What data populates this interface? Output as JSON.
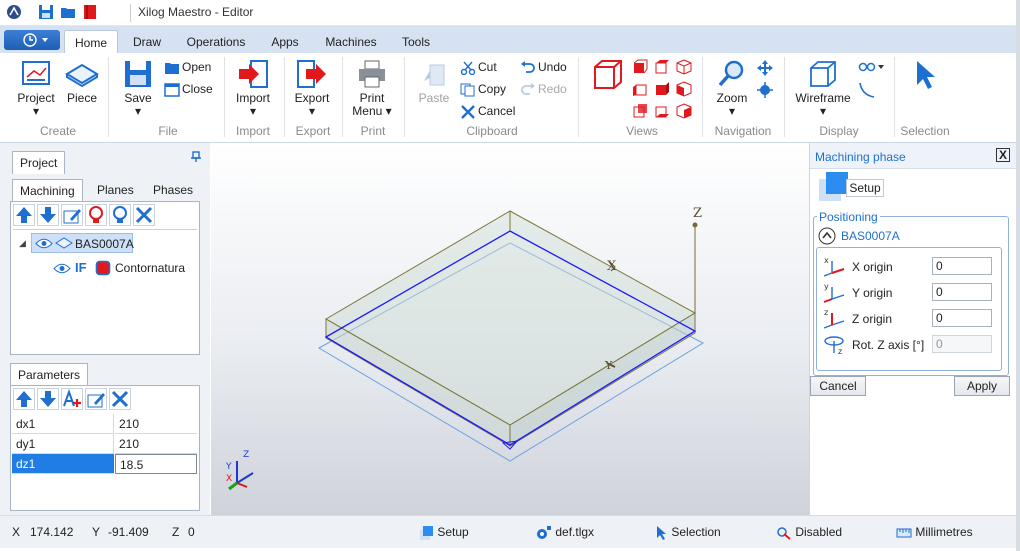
{
  "window": {
    "title": "Xilog Maestro - Editor"
  },
  "tabs": [
    {
      "label": "Home",
      "active": true
    },
    {
      "label": "Draw"
    },
    {
      "label": "Operations"
    },
    {
      "label": "Apps"
    },
    {
      "label": "Machines"
    },
    {
      "label": "Tools"
    }
  ],
  "ribbon": {
    "create": {
      "group": "Create",
      "project": "Project",
      "piece": "Piece"
    },
    "file": {
      "group": "File",
      "save": "Save",
      "open": "Open",
      "close": "Close"
    },
    "import": {
      "group": "Import",
      "import": "Import"
    },
    "export": {
      "group": "Export",
      "export": "Export"
    },
    "print": {
      "group": "Print",
      "print_line1": "Print",
      "print_line2": "Menu"
    },
    "clipboard": {
      "group": "Clipboard",
      "paste": "Paste",
      "cut": "Cut",
      "copy": "Copy",
      "cancel": "Cancel",
      "undo": "Undo",
      "redo": "Redo"
    },
    "views": {
      "group": "Views"
    },
    "navigation": {
      "group": "Navigation",
      "zoom": "Zoom"
    },
    "display": {
      "group": "Display",
      "wireframe": "Wireframe"
    },
    "selection": {
      "group": "Selection"
    }
  },
  "left_panel": {
    "project_tab": "Project",
    "subtabs": [
      "Machining",
      "Planes",
      "Phases"
    ],
    "tree": {
      "root": "BAS0007A",
      "child_code": "IF",
      "child_label": "Contornatura"
    },
    "parameters_tab": "Parameters",
    "parameters": [
      {
        "name": "dx1",
        "value": "210"
      },
      {
        "name": "dy1",
        "value": "210"
      },
      {
        "name": "dz1",
        "value": "18.5",
        "selected": true
      }
    ]
  },
  "viewport": {
    "axis_labels": {
      "x": "X",
      "y": "Y",
      "z": "Z"
    }
  },
  "right_panel": {
    "title": "Machining phase",
    "close_label": "X",
    "setup_label": "Setup",
    "positioning_label": "Positioning",
    "piece_name": "BAS0007A",
    "fields": [
      {
        "label": "X origin",
        "value": "0",
        "enabled": true
      },
      {
        "label": "Y origin",
        "value": "0",
        "enabled": true
      },
      {
        "label": "Z origin",
        "value": "0",
        "enabled": true
      },
      {
        "label": "Rot. Z axis [°]",
        "value": "0",
        "enabled": false
      }
    ],
    "cancel_button": "Cancel",
    "apply_button": "Apply"
  },
  "status": {
    "x_label": "X",
    "x_value": "174.142",
    "y_label": "Y",
    "y_value": "-91.409",
    "z_label": "Z",
    "z_value": "0",
    "phase": "Setup",
    "file": "def.tlgx",
    "mode": "Selection",
    "snap": "Disabled",
    "units": "Millimetres"
  },
  "colors": {
    "accent": "#1f6fd1",
    "red": "#e0191c",
    "ribbon_tab_bg": "#d6e2f2",
    "wire_blue": "#1a1aff",
    "wire_olive": "#7a7a3a"
  }
}
